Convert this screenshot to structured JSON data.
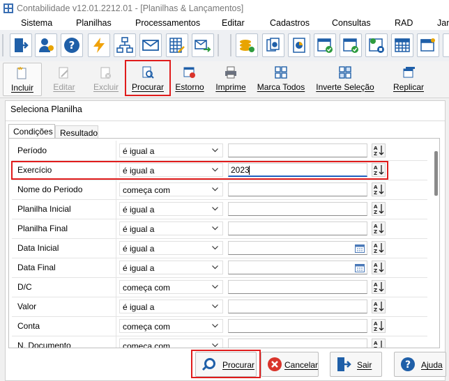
{
  "window": {
    "title": "Contabilidade v12.01.2212.01 - [Planilhas & Lançamentos]"
  },
  "menu": [
    "Sistema",
    "Planilhas",
    "Processamentos",
    "Editar",
    "Cadastros",
    "Consultas",
    "RAD",
    "Jan"
  ],
  "toolbar_icons": [
    "exit-icon",
    "users-icon",
    "help-icon",
    "lightning-icon",
    "org-chart-icon",
    "mail-icon",
    "spreadsheet-edit-icon",
    "mail-forward-icon",
    "coins-refresh-icon",
    "documents-icon",
    "pie-chart-doc-icon",
    "calendar-check-icon",
    "calendar-check-icon",
    "calendar-stop-icon",
    "calendar-grid-icon",
    "window-new-icon"
  ],
  "commands": {
    "incluir": "Incluir",
    "editar": "Editar",
    "excluir": "Excluir",
    "procurar": "Procurar",
    "estorno": "Estorno",
    "imprime": "Imprime",
    "marca_todos": "Marca Todos",
    "inverte_selecao": "Inverte Seleção",
    "replicar": "Replicar"
  },
  "panel": {
    "title": "Seleciona Planilha"
  },
  "tabs": [
    "Condições",
    "Resultado"
  ],
  "conditions": [
    {
      "field": "Período",
      "operator": "é igual a",
      "value": ""
    },
    {
      "field": "Exercício",
      "operator": "é igual a",
      "value": "2023"
    },
    {
      "field": "Nome do Periodo",
      "operator": "começa com",
      "value": ""
    },
    {
      "field": "Planilha Inicial",
      "operator": "é igual a",
      "value": ""
    },
    {
      "field": "Planilha Final",
      "operator": "é igual a",
      "value": ""
    },
    {
      "field": "Data Inicial",
      "operator": "é igual a",
      "value": ""
    },
    {
      "field": "Data Final",
      "operator": "é igual a",
      "value": ""
    },
    {
      "field": "D/C",
      "operator": "começa com",
      "value": ""
    },
    {
      "field": "Valor",
      "operator": "é igual a",
      "value": ""
    },
    {
      "field": "Conta",
      "operator": "começa com",
      "value": ""
    },
    {
      "field": "N. Documento",
      "operator": "começa com",
      "value": ""
    }
  ],
  "footer": {
    "procurar": "Procurar",
    "cancelar": "Cancelar",
    "sair": "Sair",
    "ajuda": "Ajuda"
  },
  "colors": {
    "highlight": "#e01b1b",
    "accent": "#1f5fbf"
  }
}
